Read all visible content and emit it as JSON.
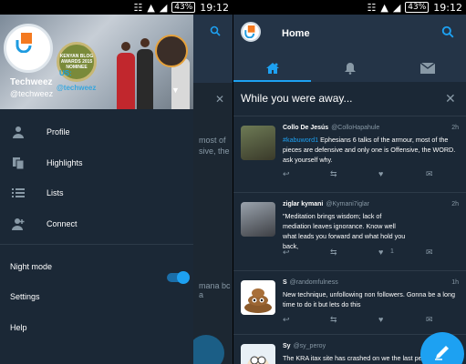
{
  "status_left": {
    "battery": "43%",
    "time": "19:12"
  },
  "status_right": {
    "battery": "43%",
    "time": "19:12"
  },
  "drawer": {
    "banner_text": "US:",
    "banner_handle_text": "@techweez",
    "banner_award_text": "KENYAN BLOG AWARDS 2015 NOMINEE",
    "username": "Techweez",
    "handle": "@techweez",
    "menu": [
      {
        "label": "Profile",
        "icon": "person-icon"
      },
      {
        "label": "Highlights",
        "icon": "highlights-icon"
      },
      {
        "label": "Lists",
        "icon": "list-icon"
      },
      {
        "label": "Connect",
        "icon": "add-person-icon"
      }
    ],
    "night_mode_label": "Night mode",
    "night_mode_on": true,
    "settings_label": "Settings",
    "help_label": "Help"
  },
  "background_timeline": {
    "snippets": [
      "most of",
      "sive, the",
      "mana bc a"
    ]
  },
  "home": {
    "title": "Home",
    "tabs": [
      {
        "name": "home",
        "icon": "home-icon",
        "active": true
      },
      {
        "name": "notifications",
        "icon": "bell-icon",
        "active": false
      },
      {
        "name": "messages",
        "icon": "envelope-icon",
        "active": false
      }
    ],
    "away_text": "While you were away...",
    "tweets": [
      {
        "name": "Collo De Jesús",
        "handle": "@ColloHapahule",
        "time": "2h",
        "tag": "#kabuword1",
        "body": " Ephesians 6 talks of the armour,  most of the pieces are defensive and only one is Offensive,  the WORD. ask yourself why.",
        "likes": ""
      },
      {
        "name": "ziglar kymani",
        "handle": "@Kymani7iglar",
        "time": "2h",
        "tag": "",
        "body": "\"Meditation brings wisdom; lack of mediation leaves ignorance. Know well what leads you forward and what hold you back,",
        "likes": "1"
      },
      {
        "name": "S",
        "handle": "@randomfulness",
        "time": "1h",
        "tag": "",
        "body": "New technique, unfollowing non followers. Gonna be a long time to do it but lets do this",
        "likes": ""
      },
      {
        "name": "Sy",
        "handle": "@sy_peroy",
        "time": "3h",
        "tag": "",
        "body": "The KRA itax site has crashed on we the last people",
        "likes": ""
      }
    ]
  },
  "colors": {
    "accent": "#1da1f2",
    "drawer_bg": "#1b2836",
    "header_bg": "#243447"
  }
}
